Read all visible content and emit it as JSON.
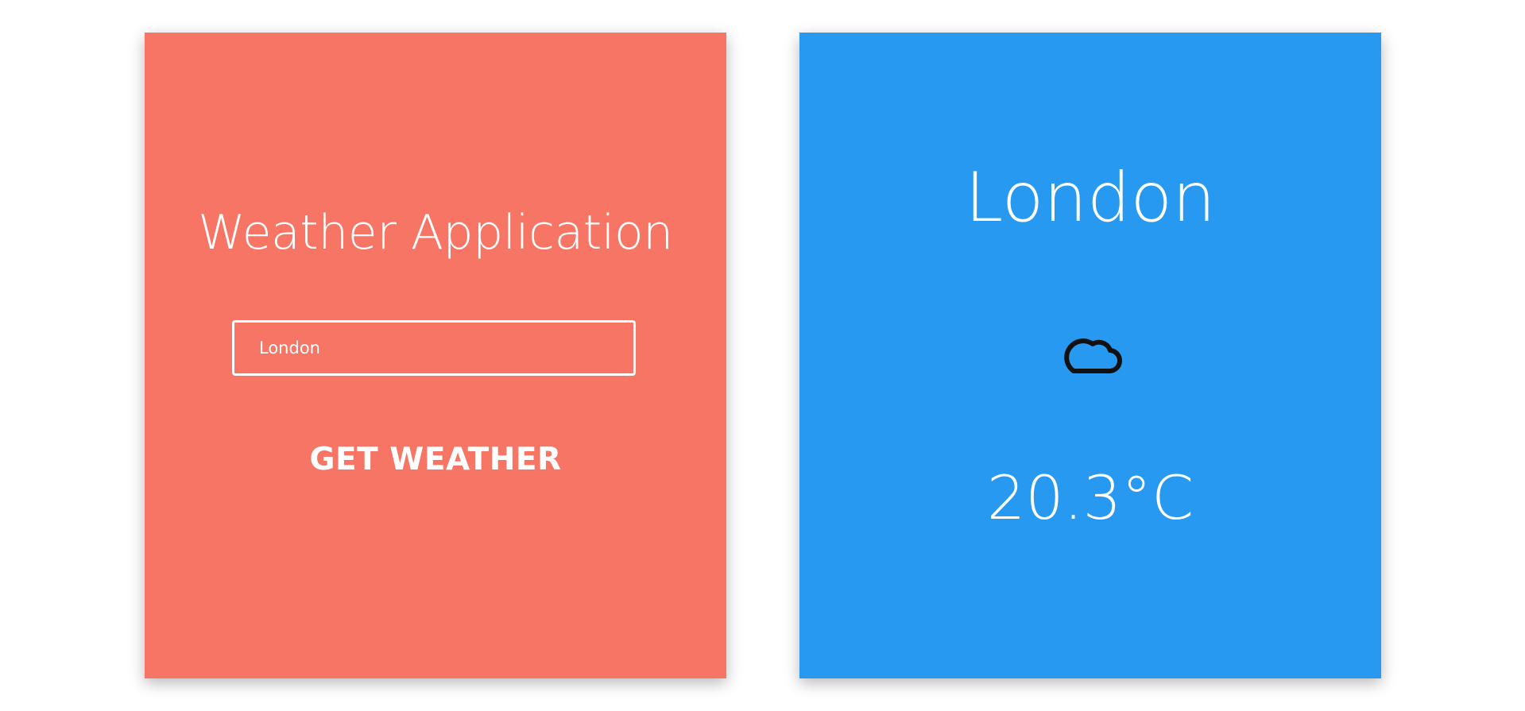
{
  "colors": {
    "left_card_bg": "#f77564",
    "right_card_bg": "#2799f0",
    "text": "#ffffff",
    "icon_stroke": "#111111"
  },
  "search_panel": {
    "title": "Weather Application",
    "input_value": "London",
    "button_label": "GET WEATHER"
  },
  "result_panel": {
    "city": "London",
    "icon": "cloud-icon",
    "temperature": "20.3°C"
  }
}
